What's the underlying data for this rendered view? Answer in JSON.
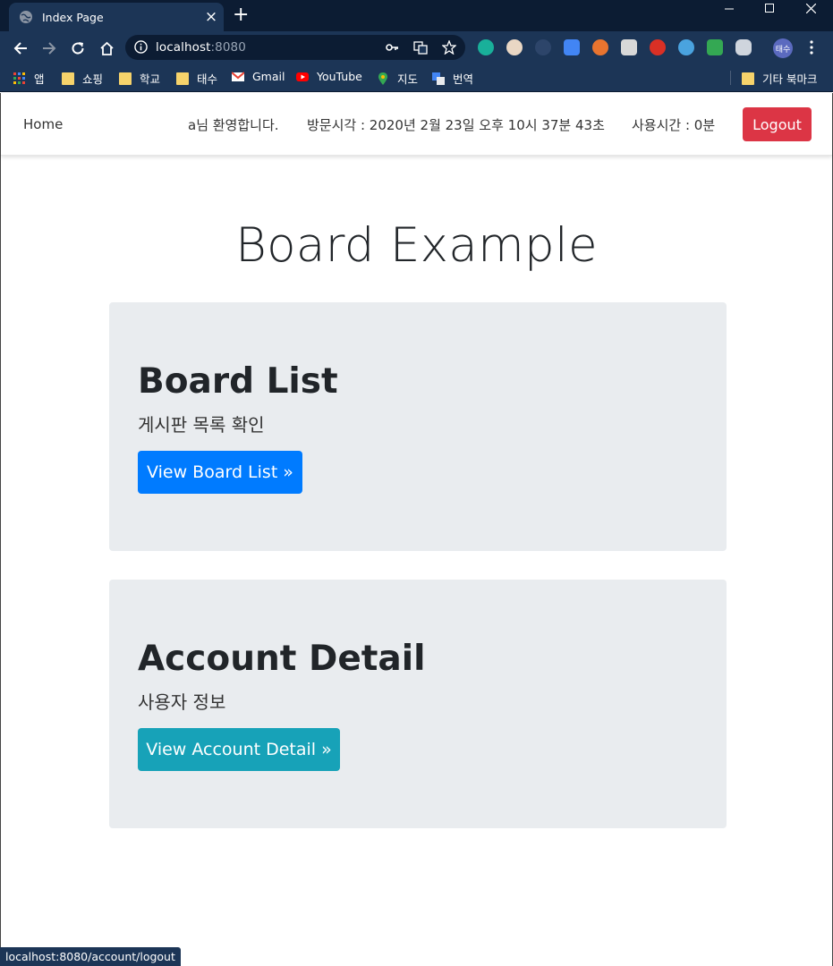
{
  "browser": {
    "tab_title": "Index Page",
    "tab_close": "×",
    "new_tab": "+",
    "url_host": "localhost",
    "url_port": ":8080",
    "profile_label": "태수",
    "bookmarks": [
      {
        "label": "앱",
        "icon": "apps-grid-icon"
      },
      {
        "label": "쇼핑",
        "icon": "folder-icon"
      },
      {
        "label": "학교",
        "icon": "folder-icon"
      },
      {
        "label": "태수",
        "icon": "folder-icon"
      },
      {
        "label": "Gmail",
        "icon": "gmail-icon"
      },
      {
        "label": "YouTube",
        "icon": "youtube-icon"
      },
      {
        "label": "지도",
        "icon": "maps-pin-icon"
      },
      {
        "label": "번역",
        "icon": "translate-icon"
      }
    ],
    "other_bookmarks": "기타 북마크",
    "status_url": "localhost:8080/account/logout",
    "colors": {
      "frame": "#0c1c33",
      "toolbar": "#1c3556"
    }
  },
  "navbar": {
    "home": "Home",
    "welcome": "a님 환영합니다.",
    "visit_time": "방문시각 : 2020년 2월 23일 오후 10시 37분 43초",
    "usage_time": "사용시간 : 0분",
    "logout": "Logout"
  },
  "main": {
    "title": "Board Example",
    "cards": [
      {
        "heading": "Board List",
        "subtitle": "게시판 목록 확인",
        "button": "View Board List »",
        "button_color": "#007bff"
      },
      {
        "heading": "Account Detail",
        "subtitle": "사용자 정보",
        "button": "View Account Detail »",
        "button_color": "#17a2b8"
      }
    ]
  }
}
